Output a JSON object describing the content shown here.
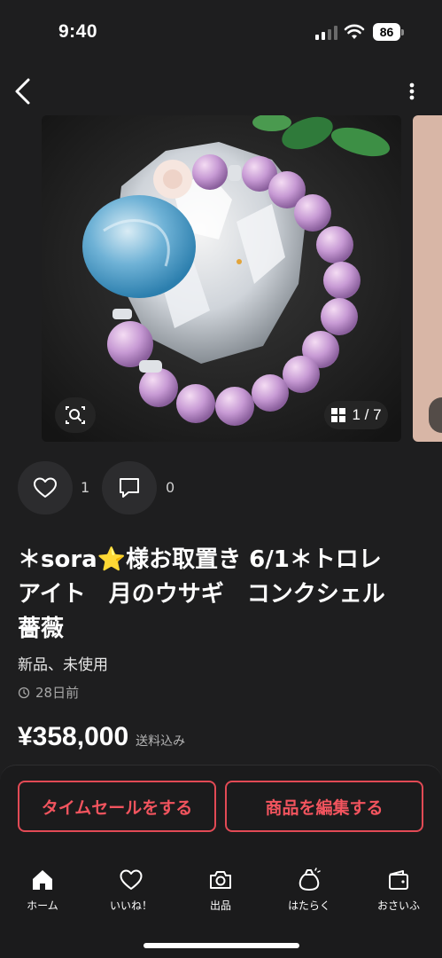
{
  "status_bar": {
    "time": "9:40",
    "battery": "86"
  },
  "carousel": {
    "page_counter": "1 / 7"
  },
  "reactions": {
    "like_count": "1",
    "comment_count": "0"
  },
  "item": {
    "title_line1": "＊sora⭐️様お取置き 6/1＊トロレ",
    "title_line2": "アイト　月のウサギ　コンクシェル",
    "title_line3": "薔薇",
    "condition": "新品、未使用",
    "posted": "28日前",
    "price": "¥358,000",
    "shipping": "送料込み"
  },
  "actions": {
    "time_sale": "タイムセールをする",
    "edit_item": "商品を編集する"
  },
  "tabbar": {
    "home": "ホーム",
    "likes": "いいね！",
    "sell": "出品",
    "work": "はたらく",
    "wallet": "おさいふ"
  },
  "colors": {
    "background": "#1e1e1f",
    "accent": "#e24a55",
    "surface": "#2c2c2e"
  }
}
